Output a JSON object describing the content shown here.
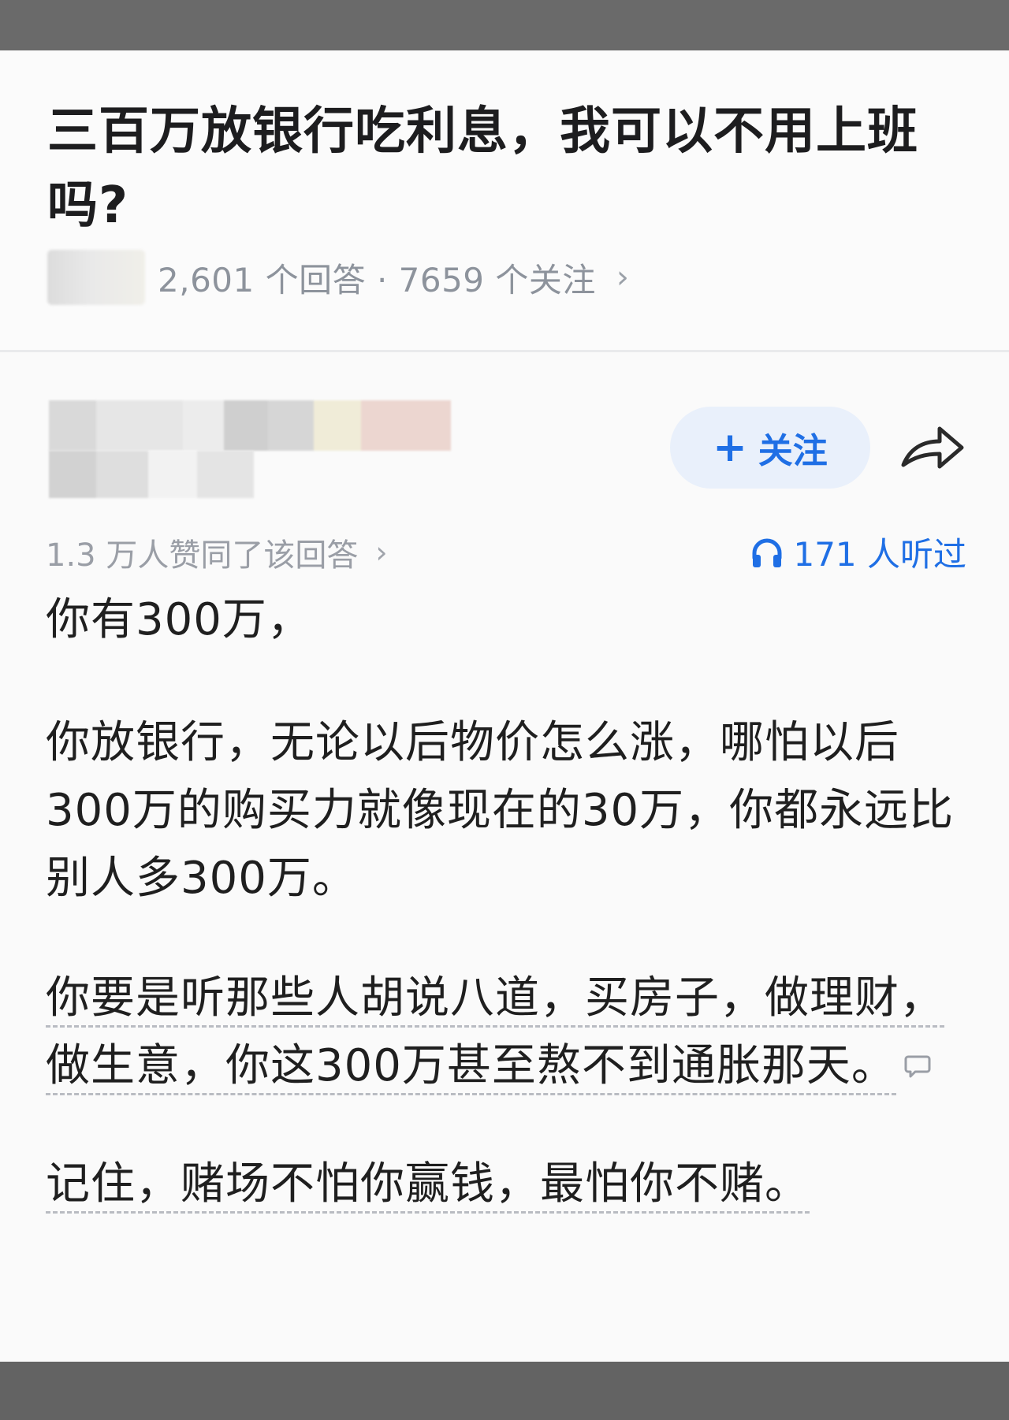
{
  "question": {
    "title": "三百万放银行吃利息，我可以不用上班吗?",
    "meta": "2,601 个回答 · 7659 个关注"
  },
  "answer": {
    "follow_label": "关注",
    "approve_text": "1.3 万人赞同了该回答",
    "listen_text": "171 人听过",
    "paragraphs": {
      "p1": "你有300万，",
      "p2": "你放银行，无论以后物价怎么涨，哪怕以后300万的购买力就像现在的30万，你都永远比别人多300万。",
      "p3": "你要是听那些人胡说八道，买房子，做理财，做生意，你这300万甚至熬不到通胀那天。",
      "p4": "记住，赌场不怕你赢钱，最怕你不赌。"
    }
  },
  "colors": {
    "accent": "#1f6fe5",
    "follow_bg": "#e9f0fb",
    "meta_text": "#8d939c"
  },
  "icons": [
    "plus-icon",
    "share-icon",
    "headphone-icon",
    "comment-icon",
    "chevron-right-icon"
  ]
}
